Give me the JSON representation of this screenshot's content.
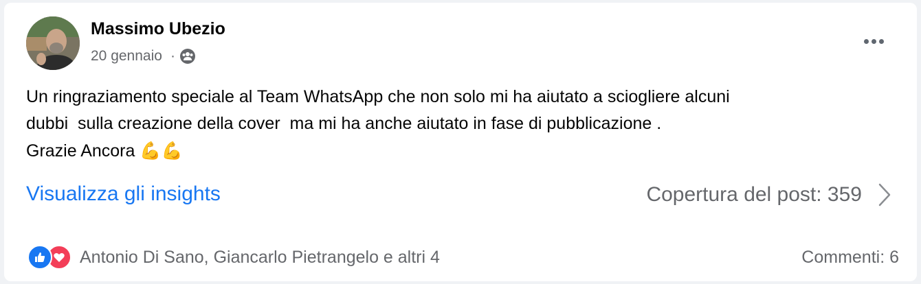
{
  "post": {
    "author": "Massimo Ubezio",
    "date": "20 gennaio",
    "separator": "·",
    "audience_icon": "friends-icon",
    "more_icon": "more-horizontal-icon",
    "text_lines": [
      "Un ringraziamento speciale al Team WhatsApp che non solo mi ha aiutato a sciogliere alcuni",
      "dubbi  sulla creazione della cover  ma mi ha anche aiutato in fase di pubblicazione .",
      "Grazie Ancora "
    ],
    "emoji": "💪💪"
  },
  "insights": {
    "link_label": "Visualizza gli insights",
    "reach_label": "Copertura del post: 359",
    "chevron_icon": "chevron-right-icon"
  },
  "footer": {
    "reaction_icons": [
      "like-icon",
      "love-icon"
    ],
    "reactors": "Antonio Di Sano, Giancarlo Pietrangelo e altri 4",
    "comments": "Commenti: 6"
  },
  "colors": {
    "link": "#1877f2",
    "secondary_text": "#65676b",
    "like": "#1877f2",
    "love": "#f33e58"
  }
}
